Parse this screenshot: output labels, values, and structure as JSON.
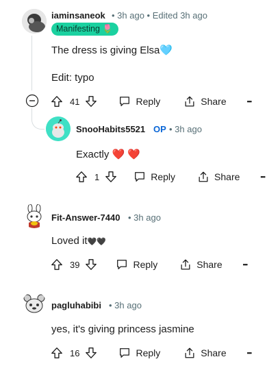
{
  "comments": [
    {
      "username": "iaminsaneok",
      "time": "3h ago",
      "edited": "Edited 3h ago",
      "flair": "Manifesting",
      "flair_emoji": "🌷",
      "text": "The dress is giving Elsa",
      "text_emoji": "🩵",
      "edit_note": "Edit: typo",
      "votes": "41",
      "reply_label": "Reply",
      "share_label": "Share",
      "more_label": "•••"
    },
    {
      "username": "SnooHabits5521",
      "op_badge": "OP",
      "time": "3h ago",
      "text": "Exactly",
      "text_emoji": "❤️ ❤️",
      "votes": "1",
      "reply_label": "Reply",
      "share_label": "Share",
      "more_label": "•••"
    },
    {
      "username": "Fit-Answer-7440",
      "time": "3h ago",
      "text": "Loved it",
      "text_emoji": "🖤🖤",
      "votes": "39",
      "reply_label": "Reply",
      "share_label": "Share",
      "more_label": "•••"
    },
    {
      "username": "pagluhabibi",
      "time": "3h ago",
      "text": "yes, it's giving princess jasmine",
      "votes": "16",
      "reply_label": "Reply",
      "share_label": "Share",
      "more_label": "•••"
    }
  ],
  "colors": {
    "flair_bg": "#1bd1a0",
    "op": "#0a66d6",
    "meta": "#576f76"
  }
}
